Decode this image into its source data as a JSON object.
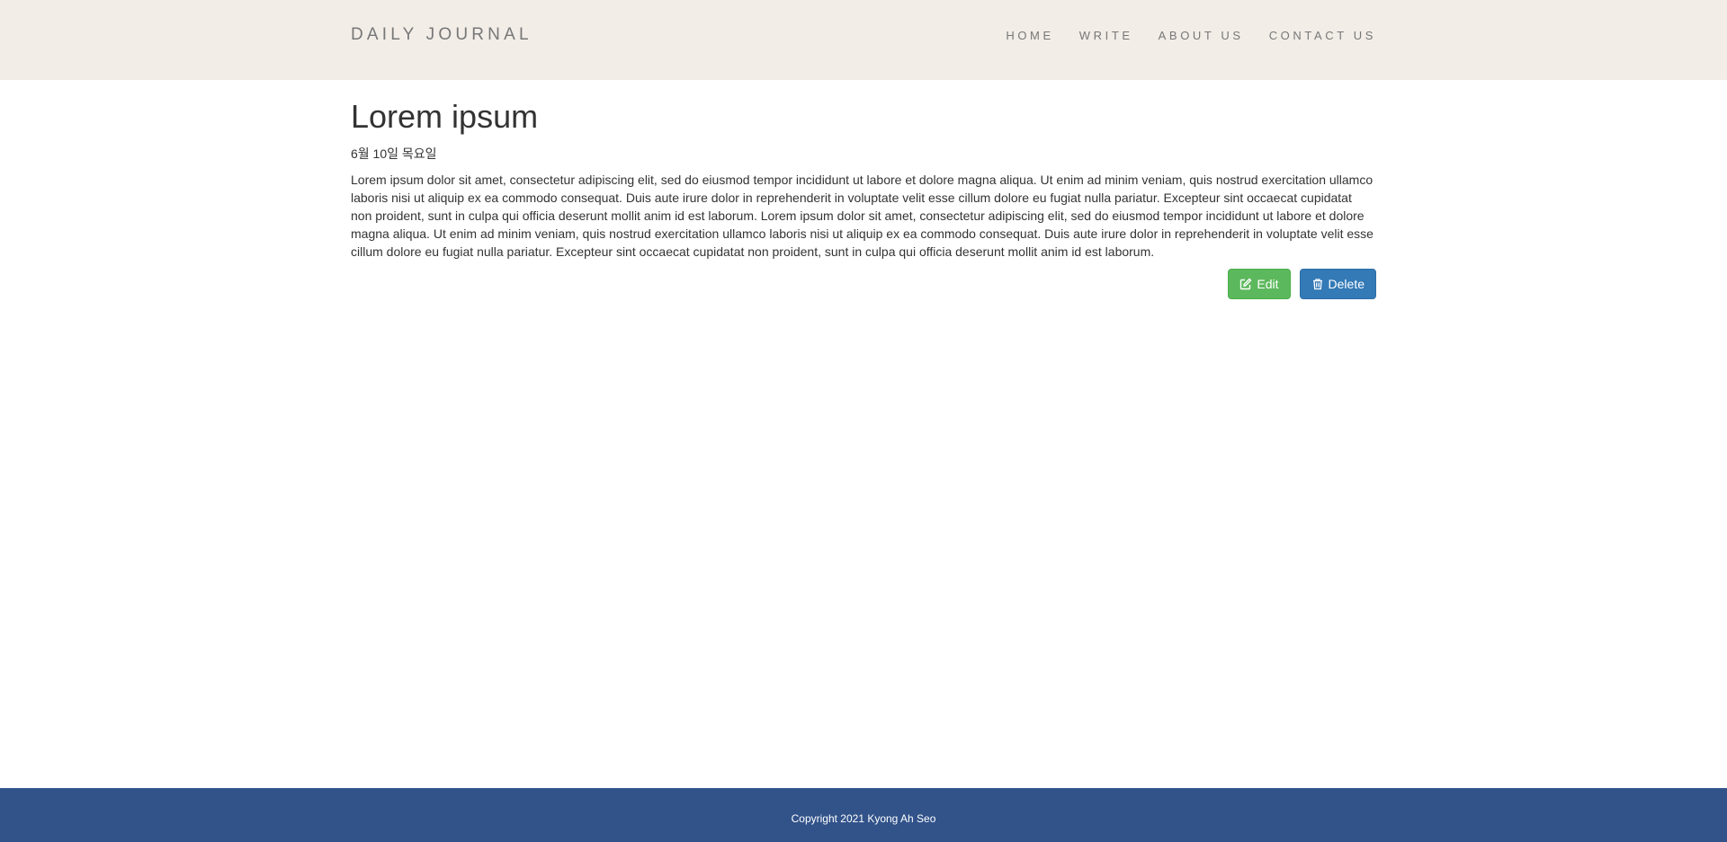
{
  "nav": {
    "brand": "DAILY JOURNAL",
    "links": [
      "HOME",
      "WRITE",
      "ABOUT US",
      "CONTACT US"
    ]
  },
  "post": {
    "title": "Lorem ipsum",
    "date": "6월 10일 목요일",
    "body": "Lorem ipsum dolor sit amet, consectetur adipiscing elit, sed do eiusmod tempor incididunt ut labore et dolore magna aliqua. Ut enim ad minim veniam, quis nostrud exercitation ullamco laboris nisi ut aliquip ex ea commodo consequat. Duis aute irure dolor in reprehenderit in voluptate velit esse cillum dolore eu fugiat nulla pariatur. Excepteur sint occaecat cupidatat non proident, sunt in culpa qui officia deserunt mollit anim id est laborum. Lorem ipsum dolor sit amet, consectetur adipiscing elit, sed do eiusmod tempor incididunt ut labore et dolore magna aliqua. Ut enim ad minim veniam, quis nostrud exercitation ullamco laboris nisi ut aliquip ex ea commodo consequat. Duis aute irure dolor in reprehenderit in voluptate velit esse cillum dolore eu fugiat nulla pariatur. Excepteur sint occaecat cupidatat non proident, sunt in culpa qui officia deserunt mollit anim id est laborum."
  },
  "actions": {
    "edit_label": "Edit",
    "edit_icon": "edit-icon",
    "delete_label": "Delete",
    "delete_icon": "trash-icon"
  },
  "footer": {
    "copyright": "Copyright 2021 Kyong Ah Seo"
  },
  "colors": {
    "navbar_bg": "#f2ede7",
    "footer_bg": "#32538a",
    "edit_button": "#5cb85c",
    "delete_button": "#337ab7"
  }
}
